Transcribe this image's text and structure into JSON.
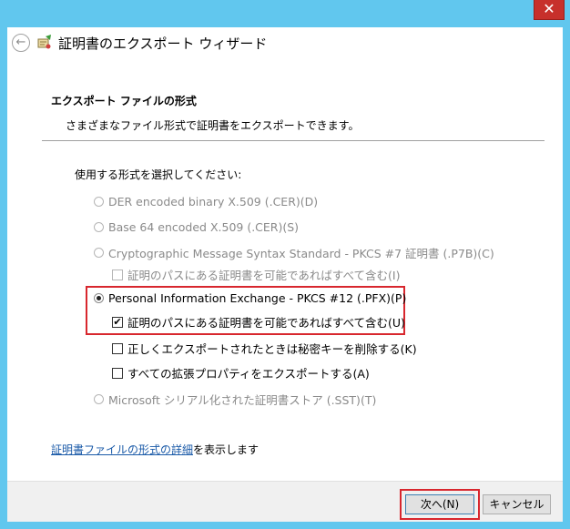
{
  "window": {
    "close_label": "✕"
  },
  "header": {
    "back_glyph": "←",
    "title": "証明書のエクスポート ウィザード"
  },
  "section": {
    "title": "エクスポート ファイルの形式",
    "description": "さまざまなファイル形式で証明書をエクスポートできます。"
  },
  "prompt": "使用する形式を選択してください:",
  "options": {
    "der": "DER encoded binary X.509 (.CER)(D)",
    "base64": "Base 64 encoded X.509 (.CER)(S)",
    "pkcs7": "Cryptographic Message Syntax Standard - PKCS #7 証明書 (.P7B)(C)",
    "pkcs7_include_path": "証明のパスにある証明書を可能であればすべて含む(I)",
    "pfx": "Personal Information Exchange - PKCS #12 (.PFX)(P)",
    "pfx_include_path": "証明のパスにある証明書を可能であればすべて含む(U)",
    "pfx_delete_key": "正しくエクスポートされたときは秘密キーを削除する(K)",
    "pfx_export_props": "すべての拡張プロパティをエクスポートする(A)",
    "sst": "Microsoft シリアル化された証明書ストア (.SST)(T)"
  },
  "footer": {
    "link_text": "証明書ファイルの形式の詳細",
    "link_suffix": "を表示します"
  },
  "buttons": {
    "next": "次へ(N)",
    "cancel": "キャンセル"
  },
  "check_glyph": "✔"
}
